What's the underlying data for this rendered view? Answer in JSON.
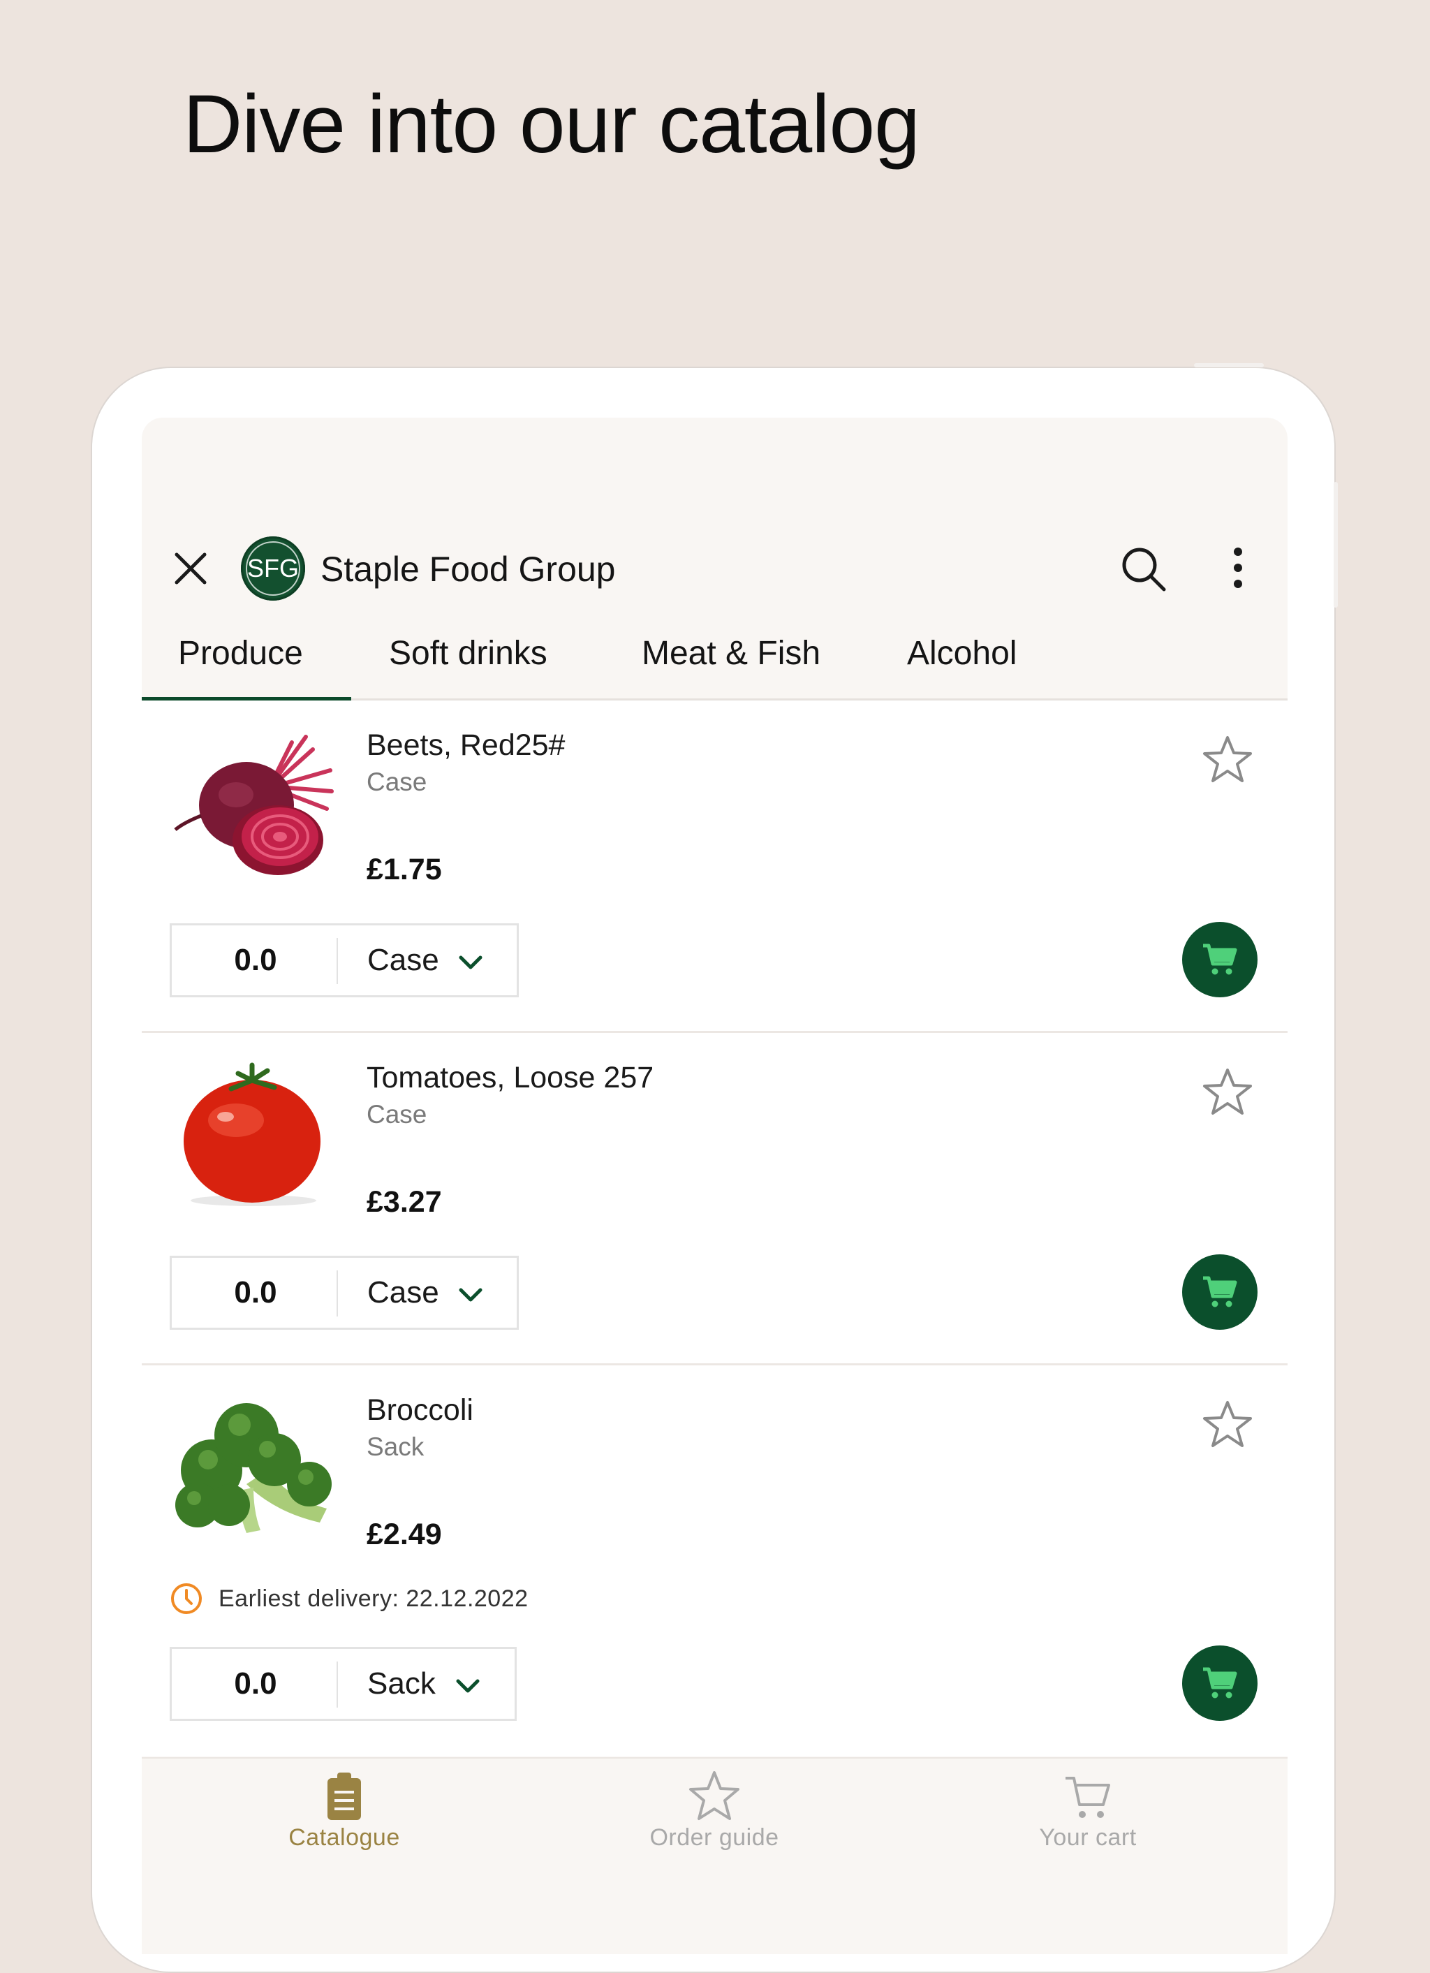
{
  "headline": "Dive into our catalog",
  "app": {
    "logo_text": "SFG",
    "title": "Staple Food Group"
  },
  "tabs": [
    {
      "label": "Produce",
      "active": true
    },
    {
      "label": "Soft drinks",
      "active": false
    },
    {
      "label": "Meat & Fish",
      "active": false
    },
    {
      "label": "Alcohol",
      "active": false
    }
  ],
  "products": [
    {
      "name": "Beets, Red25#",
      "unit": "Case",
      "price": "£1.75",
      "quantity": "0.0",
      "unit_select": "Case",
      "image_icon": "beet-image",
      "favorite": false
    },
    {
      "name": "Tomatoes, Loose 257",
      "unit": "Case",
      "price": "£3.27",
      "quantity": "0.0",
      "unit_select": "Case",
      "image_icon": "tomato-image",
      "favorite": false
    },
    {
      "name": "Broccoli",
      "unit": "Sack",
      "price": "£2.49",
      "quantity": "0.0",
      "unit_select": "Sack",
      "image_icon": "broccoli-image",
      "favorite": false,
      "delivery_note": "Earliest delivery: 22.12.2022"
    }
  ],
  "bottom_nav": [
    {
      "label": "Catalogue",
      "icon": "clipboard-icon",
      "active": true
    },
    {
      "label": "Order guide",
      "icon": "star-icon",
      "active": false
    },
    {
      "label": "Your cart",
      "icon": "cart-icon",
      "active": false
    }
  ],
  "colors": {
    "background": "#ede4de",
    "brand_green": "#0b4f2c",
    "active_nav": "#9a8343",
    "inactive_nav": "#a9a9a9",
    "delivery_icon": "#f08a24"
  }
}
